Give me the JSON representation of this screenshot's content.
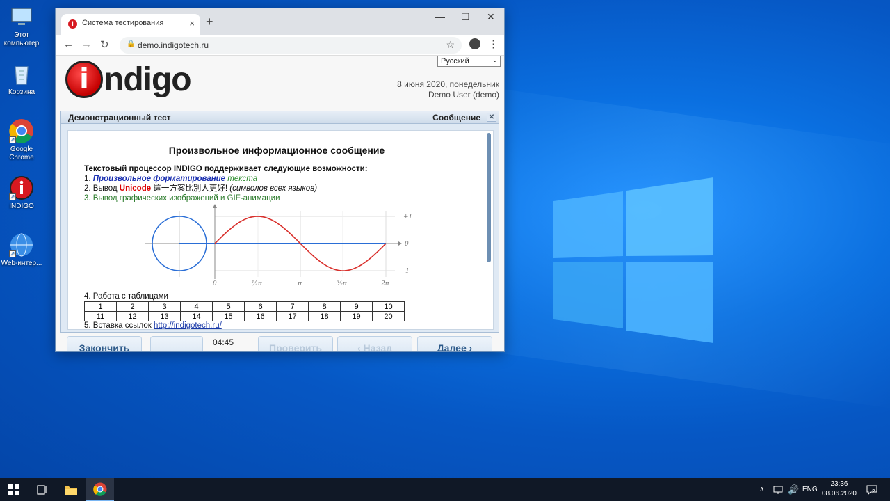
{
  "desktop": {
    "icons": [
      {
        "label": "Этот компьютер",
        "icon": "computer-icon"
      },
      {
        "label": "Корзина",
        "icon": "recycle-bin-icon"
      },
      {
        "label": "Google Chrome",
        "icon": "chrome-icon"
      },
      {
        "label": "INDIGO",
        "icon": "indigo-icon"
      },
      {
        "label": "Web-интер...",
        "icon": "globe-icon"
      }
    ]
  },
  "browser": {
    "tab_title": "Система тестирования",
    "url": "demo.indigotech.ru"
  },
  "page": {
    "logo_letter": "i",
    "logo_text": "ndigo",
    "language": "Русский",
    "date": "8 июня 2020, понедельник",
    "user": "Demo User (demo)",
    "test_title": "Демонстрационный тест",
    "panel_label": "Сообщение",
    "message": {
      "title": "Произвольное информационное сообщение",
      "intro": "Текстовый процессор INDIGO поддерживает следующие возможности:",
      "item1_num": "1.",
      "item1_a": "Произвольное форматирование",
      "item1_b": "текста",
      "item2_num": "2. Вывод",
      "item2_unicode": "Unicode",
      "item2_chars": "這一方案比別人更好!",
      "item2_note": "(символов всех языков)",
      "item3": "3. Вывод графических изображений и GIF-анимации",
      "item4": "4. Работа с таблицами",
      "table": [
        [
          "1",
          "2",
          "3",
          "4",
          "5",
          "6",
          "7",
          "8",
          "9",
          "10"
        ],
        [
          "11",
          "12",
          "13",
          "14",
          "15",
          "16",
          "17",
          "18",
          "19",
          "20"
        ]
      ],
      "item5_text": "5. Вставка ссылок",
      "item5_link": "http://indigotech.ru/"
    },
    "graph": {
      "ticks_x": [
        "0",
        "½π",
        "π",
        "³⁄₂π",
        "2π"
      ],
      "ticks_y": [
        "+1",
        "0",
        "-1"
      ]
    },
    "buttons": {
      "finish": "Закончить",
      "timer": "04:45",
      "check": "Проверить",
      "back": "‹ Назад",
      "next": "Далее ›"
    }
  },
  "taskbar": {
    "lang": "ENG",
    "time": "23:36",
    "date": "08.06.2020",
    "notifications": "2"
  },
  "colors": {
    "accent": "#2d5a8a",
    "sine": "#d9302c",
    "circle": "#2a6ed6"
  }
}
